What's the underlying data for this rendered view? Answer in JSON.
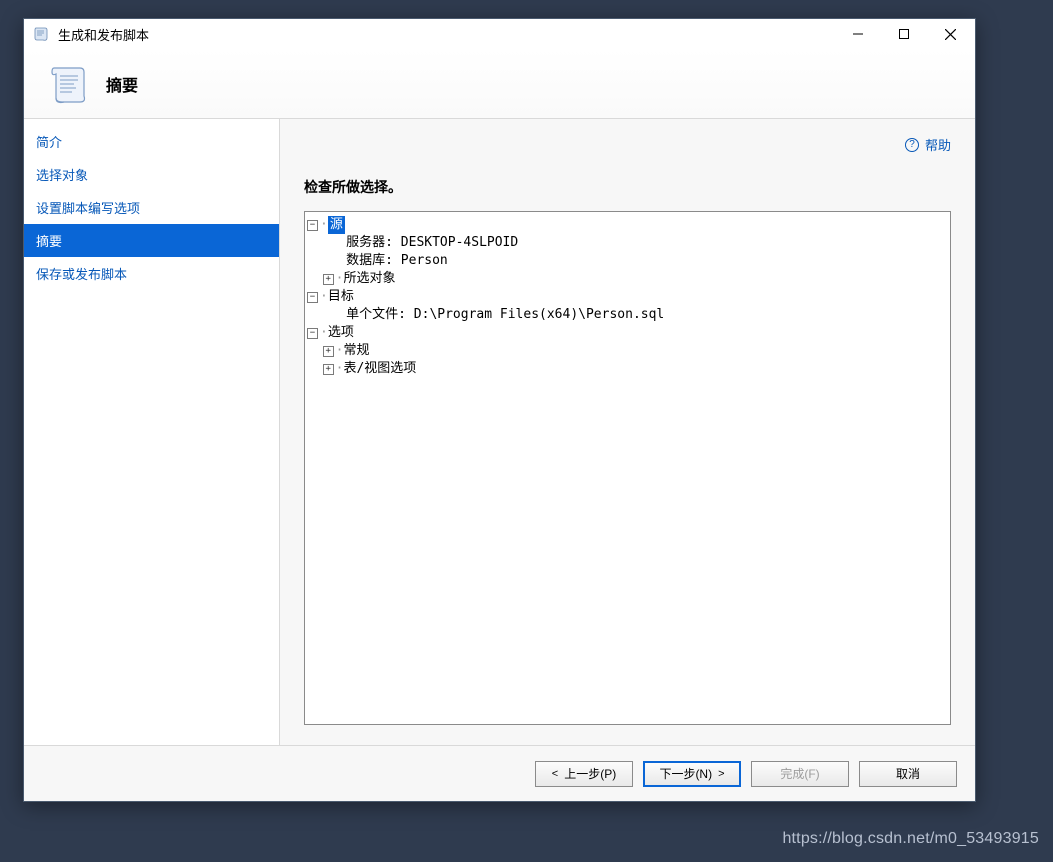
{
  "window": {
    "title": "生成和发布脚本"
  },
  "header": {
    "title": "摘要"
  },
  "sidebar": {
    "items": [
      {
        "label": "简介",
        "selected": false
      },
      {
        "label": "选择对象",
        "selected": false
      },
      {
        "label": "设置脚本编写选项",
        "selected": false
      },
      {
        "label": "摘要",
        "selected": true
      },
      {
        "label": "保存或发布脚本",
        "selected": false
      }
    ]
  },
  "main": {
    "help_label": "帮助",
    "instruction": "检查所做选择。",
    "tree": {
      "source": {
        "label": "源",
        "server_label": "服务器:",
        "server_value": "DESKTOP-4SLPOID",
        "db_label": "数据库:",
        "db_value": "Person",
        "selected_objects_label": "所选对象"
      },
      "target": {
        "label": "目标",
        "single_file_label": "单个文件:",
        "single_file_value": "D:\\Program Files(x64)\\Person.sql"
      },
      "options": {
        "label": "选项",
        "general_label": "常规",
        "table_view_label": "表/视图选项"
      }
    }
  },
  "footer": {
    "prev": "上一步(P)",
    "next": "下一步(N)",
    "finish": "完成(F)",
    "cancel": "取消"
  },
  "watermark": "https://blog.csdn.net/m0_53493915"
}
